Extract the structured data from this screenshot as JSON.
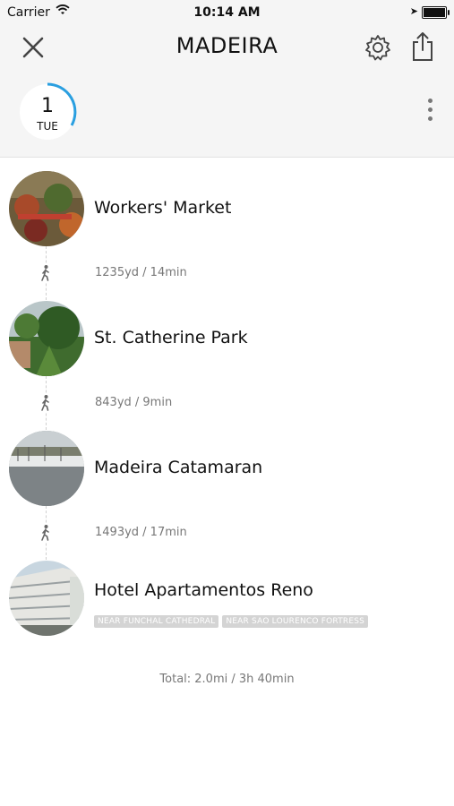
{
  "status_bar": {
    "carrier": "Carrier",
    "time": "10:14 AM"
  },
  "nav": {
    "title": "MADEIRA",
    "close_icon": "close-icon",
    "settings_icon": "gear-icon",
    "share_icon": "share-icon"
  },
  "day": {
    "number": "1",
    "weekday": "TUE"
  },
  "itinerary": {
    "stops": [
      {
        "name": "Workers' Market",
        "thumb": "market-photo"
      },
      {
        "name": "St. Catherine Park",
        "thumb": "park-photo"
      },
      {
        "name": "Madeira Catamaran",
        "thumb": "harbor-photo"
      },
      {
        "name": "Hotel Apartamentos Reno",
        "thumb": "hotel-photo",
        "tags": [
          "NEAR FUNCHAL CATHEDRAL",
          "NEAR SAO LOURENCO FORTRESS"
        ]
      }
    ],
    "legs": [
      {
        "distance": "1235yd / 14min",
        "mode_icon": "walk-icon"
      },
      {
        "distance": "843yd / 9min",
        "mode_icon": "walk-icon"
      },
      {
        "distance": "1493yd / 17min",
        "mode_icon": "walk-icon"
      }
    ],
    "total": "Total: 2.0mi / 3h 40min"
  },
  "colors": {
    "accent": "#2a9fe0",
    "header_bg": "#f5f5f5",
    "tag_bg": "#d4d4d4"
  }
}
